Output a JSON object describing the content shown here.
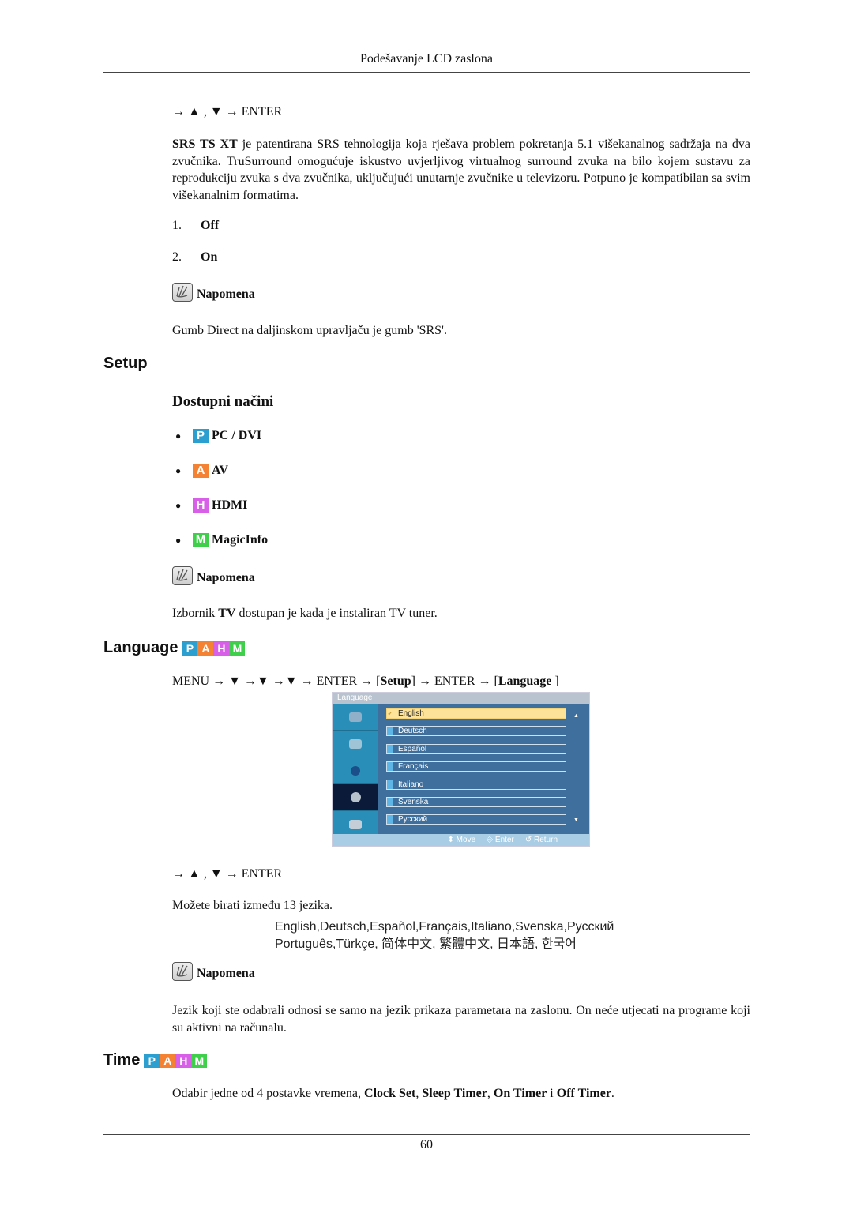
{
  "header": {
    "running_title": "Podešavanje LCD zaslona"
  },
  "srs": {
    "nav": "→ ▲ , ▼ → ENTER",
    "intro_bold": "SRS TS XT",
    "intro_text": " je patentirana SRS tehnologija koja rješava problem pokretanja 5.1 višekanalnog sadržaja na dva zvučnika. TruSurround omogućuje iskustvo uvjerljivog virtualnog surround zvuka na bilo kojem sustavu za reprodukciju zvuka s dva zvučnika, uključujući unutarnje zvučnike u televizoru. Potpuno je kompatibilan sa svim višekanalnim formatima.",
    "options": [
      {
        "num": "1.",
        "label": "Off"
      },
      {
        "num": "2.",
        "label": "On"
      }
    ],
    "note_label": "Napomena",
    "note_text": "Gumb Direct na daljinskom upravljaču je gumb 'SRS'."
  },
  "setup": {
    "heading": "Setup",
    "subheading": "Dostupni načini",
    "modes": [
      {
        "letter": "P",
        "label": "PC / DVI",
        "color": "#2a9fd0"
      },
      {
        "letter": "A",
        "label": "AV",
        "color": "#f58232"
      },
      {
        "letter": "H",
        "label": "HDMI",
        "color": "#d860e8"
      },
      {
        "letter": "M",
        "label": "MagicInfo",
        "color": "#3fcf4a"
      }
    ],
    "note_label": "Napomena",
    "note_pre": "Izbornik ",
    "note_bold": "TV",
    "note_post": " dostupan je kada je instaliran TV tuner."
  },
  "language": {
    "heading": "Language",
    "badges": [
      "P",
      "A",
      "H",
      "M"
    ],
    "nav_pre": "MENU → ▼ →▼ →▼ → ENTER → [",
    "nav_b1": "Setup",
    "nav_mid": "] → ENTER → [",
    "nav_b2": "Language",
    "nav_post": " ]",
    "osd": {
      "title": "Language",
      "items": [
        "English",
        "Deutsch",
        "Español",
        "Français",
        "Italiano",
        "Svenska",
        "Русский"
      ],
      "selected": "English",
      "footer": {
        "move": "Move",
        "enter": "Enter",
        "return": "Return"
      }
    },
    "nav2": "→ ▲ , ▼ → ENTER",
    "count_text": "Možete birati između 13 jezika.",
    "lang_line1": "English,Deutsch,Español,Français,Italiano,Svenska,Русский",
    "lang_line2": "Português,Türkçe, 简体中文,  繁體中文, 日本語, 한국어",
    "note_label": "Napomena",
    "note_text": "Jezik koji ste odabrali odnosi se samo na jezik prikaza parametara na zaslonu. On neće utjecati na programe koji su aktivni na računalu."
  },
  "time": {
    "heading": "Time",
    "badges": [
      "P",
      "A",
      "H",
      "M"
    ],
    "text_pre": "Odabir jedne od 4 postavke vremena, ",
    "b1": "Clock Set",
    "sep1": ", ",
    "b2": "Sleep Timer",
    "sep2": ", ",
    "b3": "On Timer",
    "sep3": " i ",
    "b4": "Off Timer",
    "text_post": "."
  },
  "footer": {
    "page_number": "60"
  },
  "colors": {
    "P": "#2a9fd0",
    "A": "#f58232",
    "H": "#d860e8",
    "M": "#3fcf4a"
  }
}
